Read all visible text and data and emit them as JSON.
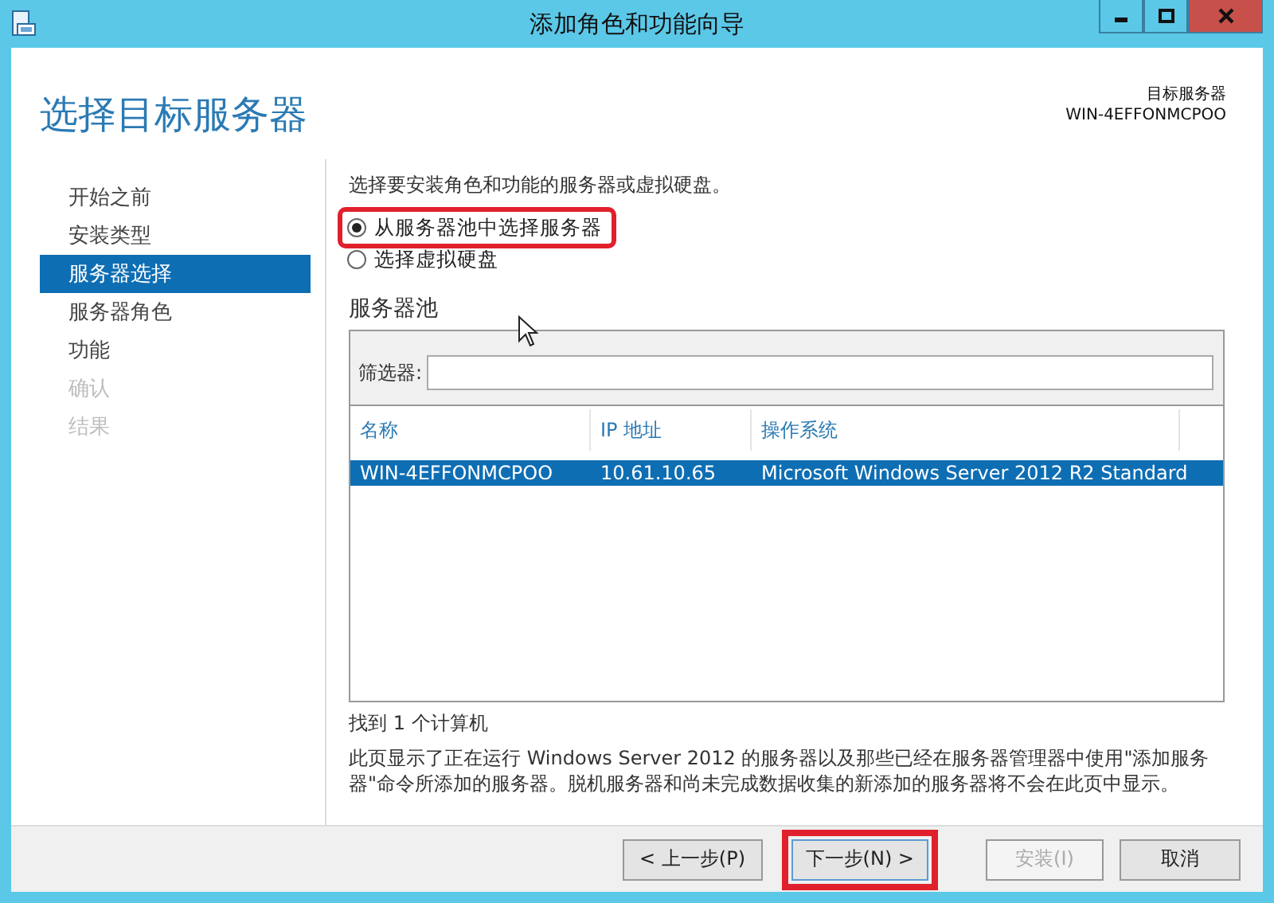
{
  "window": {
    "title": "添加角色和功能向导"
  },
  "header": {
    "title": "选择目标服务器",
    "target_label": "目标服务器",
    "target_name": "WIN-4EFFONMCPOO"
  },
  "nav": [
    {
      "label": "开始之前",
      "selected": false,
      "disabled": false
    },
    {
      "label": "安装类型",
      "selected": false,
      "disabled": false
    },
    {
      "label": "服务器选择",
      "selected": true,
      "disabled": false
    },
    {
      "label": "服务器角色",
      "selected": false,
      "disabled": false
    },
    {
      "label": "功能",
      "selected": false,
      "disabled": false
    },
    {
      "label": "确认",
      "selected": false,
      "disabled": true
    },
    {
      "label": "结果",
      "selected": false,
      "disabled": true
    }
  ],
  "instruction": "选择要安装角色和功能的服务器或虚拟硬盘。",
  "options": [
    {
      "label": "从服务器池中选择服务器",
      "selected": true,
      "highlighted": true
    },
    {
      "label": "选择虚拟硬盘",
      "selected": false,
      "highlighted": false
    }
  ],
  "pool": {
    "title": "服务器池",
    "filter_label": "筛选器:",
    "columns": [
      "名称",
      "IP 地址",
      "操作系统"
    ],
    "rows": [
      {
        "cells": [
          "WIN-4EFFONMCPOO",
          "10.61.10.65",
          "Microsoft Windows Server 2012 R2 Standard"
        ],
        "selected": true
      }
    ]
  },
  "found": "找到 1 个计算机",
  "note": "此页显示了正在运行 Windows Server 2012 的服务器以及那些已经在服务器管理器中使用\"添加服务器\"命令所添加的服务器。脱机服务器和尚未完成数据收集的新添加的服务器将不会在此页中显示。",
  "buttons": [
    {
      "label": "< 上一步(P)",
      "disabled": false,
      "highlighted": false
    },
    {
      "label": "下一步(N) >",
      "disabled": false,
      "highlighted": true
    },
    {
      "label": "安装(I)",
      "disabled": true,
      "highlighted": false
    },
    {
      "label": "取消",
      "disabled": false,
      "highlighted": false
    }
  ]
}
